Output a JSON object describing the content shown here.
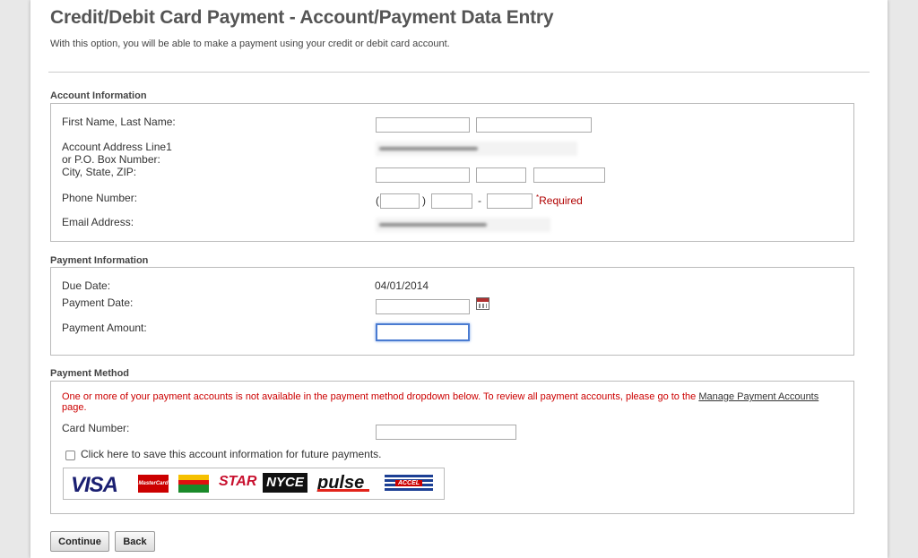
{
  "header": {
    "title": "Credit/Debit Card Payment - Account/Payment Data Entry",
    "intro": "With this option, you will be able to make a payment using your credit or debit card account."
  },
  "account": {
    "section_label": "Account Information",
    "name_label": "First Name, Last Name:",
    "address_label_1": "Account Address Line1",
    "address_label_2": "or P.O. Box Number:",
    "city_label": "City, State, ZIP:",
    "phone_label": "Phone Number:",
    "phone_open": "(",
    "phone_close": ")",
    "phone_dash": "-",
    "required_mark": "*",
    "required_text": "Required",
    "email_label": "Email Address:"
  },
  "payment": {
    "section_label": "Payment Information",
    "due_date_label": "Due Date:",
    "due_date_value": "04/01/2014",
    "payment_date_label": "Payment Date:",
    "payment_amount_label": "Payment Amount:"
  },
  "method": {
    "section_label": "Payment Method",
    "warning_text": "One or more of your payment accounts is not available in the payment method dropdown below. To review all payment accounts, please go to the ",
    "warning_link": "Manage Payment Accounts",
    "warning_tail": " page.",
    "card_number_label": "Card Number:",
    "save_checkbox_label": "Click here to save this account information for future payments.",
    "logos": {
      "visa": "VISA",
      "mastercard": "MasterCard",
      "star": "STAR",
      "nyce": "NYCE",
      "pulse": "pulse",
      "accel": "ACCEL"
    }
  },
  "buttons": {
    "continue": "Continue",
    "back": "Back"
  },
  "colors": {
    "required": "#b00000",
    "warning": "#cc0000",
    "focus": "#4a7bd1"
  }
}
